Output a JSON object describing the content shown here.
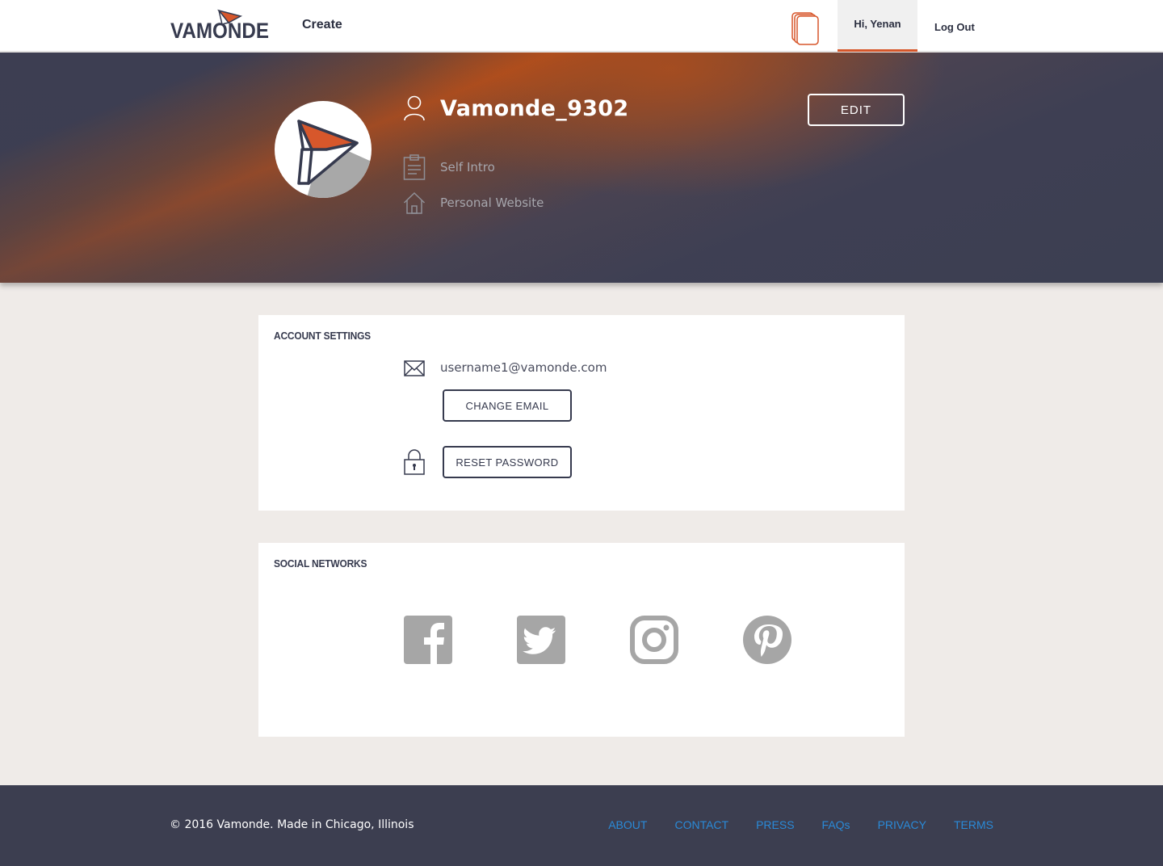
{
  "header": {
    "logo_text": "VAMONDE",
    "create_label": "Create",
    "docs_icon": "documents-icon",
    "user_greeting": "Hi, Yenan",
    "logout_label": "Log Out"
  },
  "profile": {
    "username": "Vamonde_9302",
    "self_intro_placeholder": "Self Intro",
    "website_placeholder": "Personal Website",
    "edit_label": "EDIT"
  },
  "account_settings": {
    "title": "ACCOUNT SETTINGS",
    "email": "username1@vamonde.com",
    "change_email_label": "CHANGE EMAIL",
    "reset_password_label": "RESET PASSWORD"
  },
  "social_networks": {
    "title": "SOCIAL NETWORKS",
    "networks": [
      "facebook-icon",
      "twitter-icon",
      "instagram-icon",
      "pinterest-icon"
    ]
  },
  "footer": {
    "copyright": "© 2016 Vamonde. Made in Chicago, Illinois",
    "links": [
      "ABOUT",
      "CONTACT",
      "PRESS",
      "FAQs",
      "PRIVACY",
      "TERMS"
    ]
  },
  "colors": {
    "brand_orange": "#d7572b",
    "navy": "#363a4e",
    "footer_bg": "#3c3e50",
    "link_blue": "#2a8ad8",
    "icon_gray": "#a6a6a6"
  }
}
